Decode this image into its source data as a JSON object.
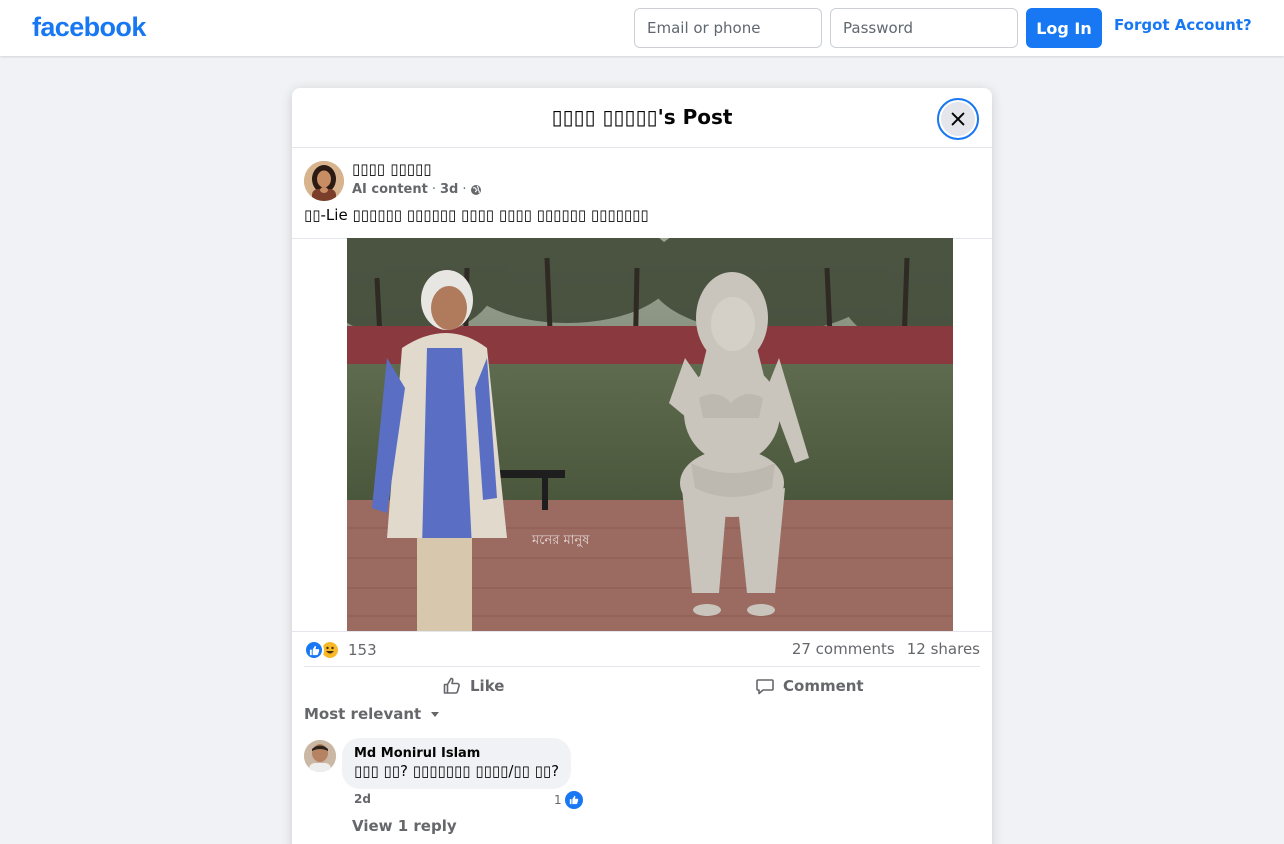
{
  "topbar": {
    "logo": "facebook",
    "email_placeholder": "Email or phone",
    "password_placeholder": "Password",
    "login_label": "Log In",
    "forgot_label": "Forgot Account?"
  },
  "modal": {
    "title": "▯▯▯▯ ▯▯▯▯▯'s Post",
    "close_icon": "close-icon"
  },
  "post": {
    "author": "▯▯▯▯ ▯▯▯▯▯",
    "ai_label": "AI content",
    "separator": "·",
    "time": "3d",
    "privacy_icon": "globe-icon",
    "text": "▯▯-Lie ▯▯▯▯▯▯ ▯▯▯▯▯▯ ▯▯▯▯ ▯▯▯▯ ▯▯▯▯▯▯ ▯▯▯▯▯▯▯",
    "image_watermark": "মনের মানুষ"
  },
  "stats": {
    "reaction_count": "153",
    "comments": "27 comments",
    "shares": "12 shares"
  },
  "actions": {
    "like": "Like",
    "comment": "Comment"
  },
  "comments_section": {
    "sort_label": "Most relevant",
    "items": [
      {
        "name": "Md Monirul Islam",
        "text": "▯▯▯ ▯▯? ▯▯▯▯▯▯▯ ▯▯▯▯/▯▯ ▯▯?",
        "time": "2d",
        "like_count": "1",
        "view_reply": "View 1 reply"
      }
    ]
  },
  "colors": {
    "brand": "#1877f2",
    "page_bg": "#f0f2f5",
    "secondary_text": "#65676b"
  }
}
